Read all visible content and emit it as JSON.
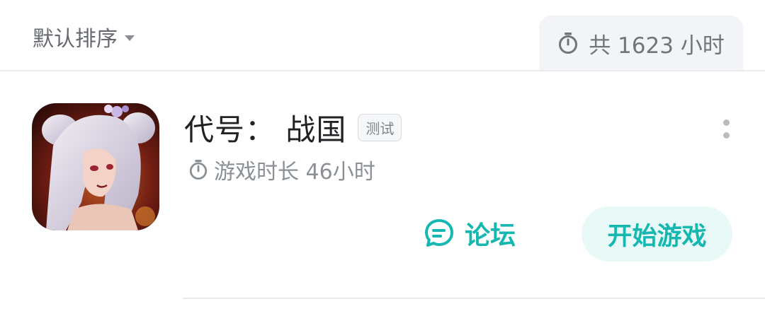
{
  "header": {
    "sort_label": "默认排序",
    "total_playtime": "共 1623 小时"
  },
  "game": {
    "title": "代号：  战国",
    "tag": "测试",
    "playtime": "游戏时长 46小时",
    "forum_label": "论坛",
    "start_label": "开始游戏"
  },
  "colors": {
    "accent": "#14b8b1",
    "accent_bg": "#e8f9f8",
    "muted_text": "#8b9096"
  },
  "icons": {
    "sort_caret": "caret-down-icon",
    "timer": "stopwatch-icon",
    "forum": "chat-bubble-icon",
    "more": "more-vertical-icon"
  }
}
